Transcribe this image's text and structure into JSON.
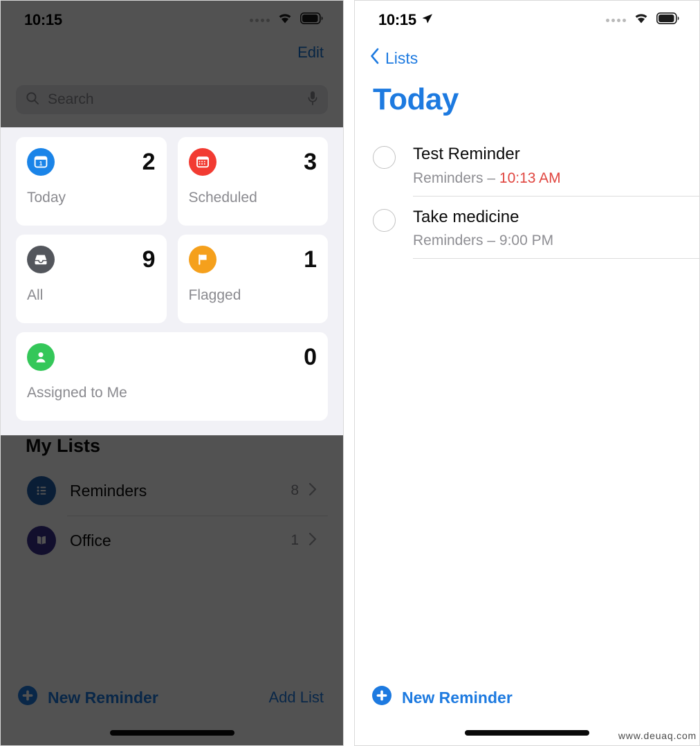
{
  "colors": {
    "accent_blue": "#1d7ae0",
    "today_icon": "#1a84e8",
    "scheduled_icon": "#f23b32",
    "all_icon": "#53565c",
    "flagged_icon": "#f5a01c",
    "assigned_icon": "#34c759",
    "reminders_list_icon": "#1f5fa8",
    "office_list_icon": "#3a2f8c",
    "overdue_red": "#e0453f",
    "region_bg": "#f1f1f6",
    "dim_overlay": "#484848"
  },
  "left_phone": {
    "statusbar": {
      "time": "10:15",
      "signal_icon": "signal-dots-icon",
      "wifi_icon": "wifi-icon",
      "battery_icon": "battery-icon"
    },
    "edit_button": "Edit",
    "search": {
      "placeholder": "Search",
      "value": "",
      "search_icon": "search-icon",
      "mic_icon": "microphone-icon"
    },
    "smart_cards": [
      {
        "label": "Today",
        "count": "2",
        "icon": "calendar-today-icon",
        "color": "#1a84e8"
      },
      {
        "label": "Scheduled",
        "count": "3",
        "icon": "calendar-icon",
        "color": "#f23b32"
      },
      {
        "label": "All",
        "count": "9",
        "icon": "inbox-tray-icon",
        "color": "#53565c"
      },
      {
        "label": "Flagged",
        "count": "1",
        "icon": "flag-icon",
        "color": "#f5a01c"
      },
      {
        "label": "Assigned to Me",
        "count": "0",
        "icon": "person-icon",
        "color": "#34c759"
      }
    ],
    "my_lists": {
      "title": "My Lists",
      "rows": [
        {
          "name": "Reminders",
          "count": "8",
          "icon": "bulleted-list-icon",
          "color": "#1f5fa8"
        },
        {
          "name": "Office",
          "count": "1",
          "icon": "open-book-icon",
          "color": "#3a2f8c"
        }
      ]
    },
    "toolbar": {
      "new_reminder": "New Reminder",
      "add_list": "Add List",
      "plus_icon": "plus-circle-icon"
    }
  },
  "right_phone": {
    "statusbar": {
      "time": "10:15",
      "location_icon": "location-arrow-icon",
      "signal_icon": "signal-dots-icon",
      "wifi_icon": "wifi-icon",
      "battery_icon": "battery-icon"
    },
    "back_button": {
      "label": "Lists",
      "icon": "chevron-left-icon"
    },
    "title": "Today",
    "reminders": [
      {
        "title": "Test Reminder",
        "list_name": "Reminders",
        "separator": "–",
        "due": "10:13 AM",
        "overdue": true
      },
      {
        "title": "Take medicine",
        "list_name": "Reminders",
        "separator": "–",
        "due": "9:00 PM",
        "overdue": false
      }
    ],
    "toolbar": {
      "new_reminder": "New Reminder",
      "plus_icon": "plus-circle-icon"
    }
  },
  "watermark": "www.deuaq.com"
}
